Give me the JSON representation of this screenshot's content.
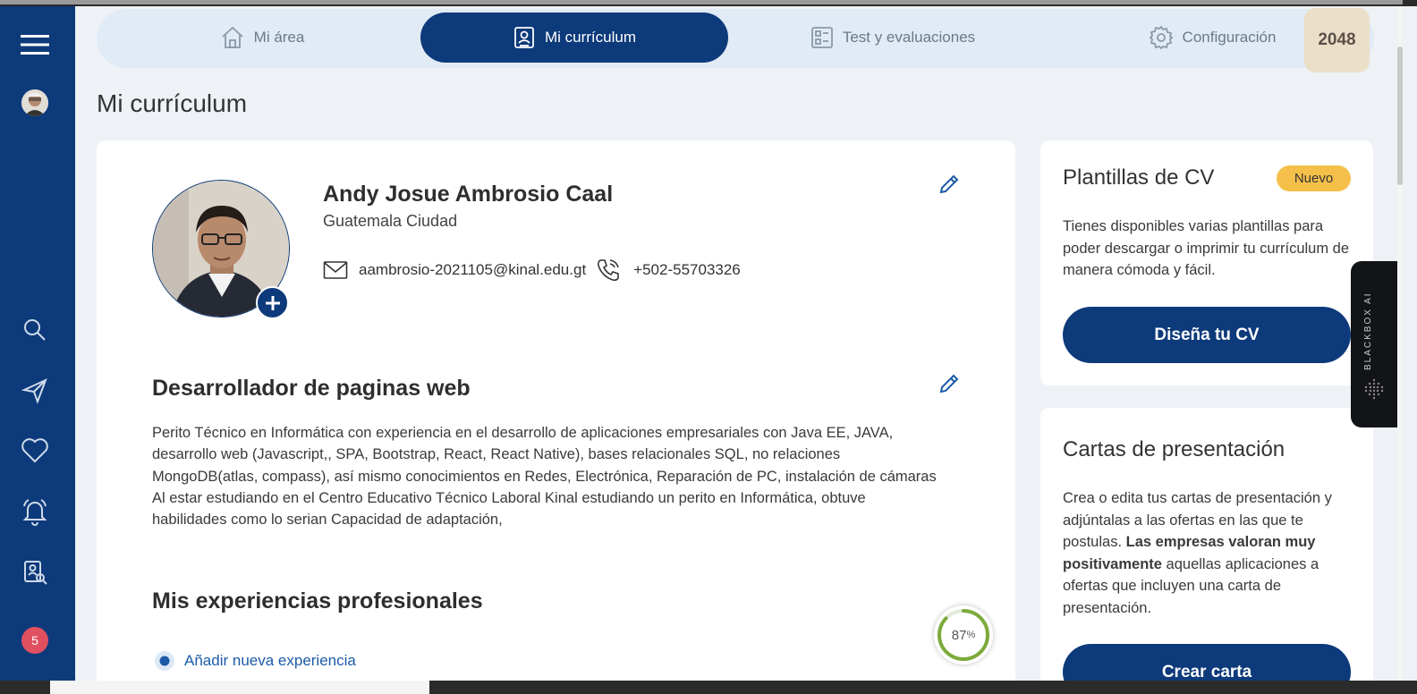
{
  "nav": {
    "tabs": [
      {
        "label": "Mi área",
        "icon": "home-icon"
      },
      {
        "label": "Mi currículum",
        "icon": "resume-icon"
      },
      {
        "label": "Test y evaluaciones",
        "icon": "checklist-icon"
      },
      {
        "label": "Configuración",
        "icon": "gear-icon"
      }
    ],
    "active_tab": "Mi currículum",
    "score": "2048"
  },
  "sidebar": {
    "icons": [
      "menu-icon",
      "avatar",
      "search-icon",
      "send-icon",
      "heart-icon",
      "bell-icon",
      "search-profile-icon"
    ],
    "notification_count": "5"
  },
  "page": {
    "title": "Mi currículum"
  },
  "profile": {
    "name": "Andy Josue Ambrosio Caal",
    "city": "Guatemala Ciudad",
    "email": "aambrosio-2021105@kinal.edu.gt",
    "phone": "+502-55703326"
  },
  "summary": {
    "headline": "Desarrollador de paginas web",
    "description": "Perito Técnico en Informática con experiencia en el desarrollo de aplicaciones empresariales con Java EE, JAVA, desarrollo web (Javascript,, SPA, Bootstrap, React, React Native), bases relacionales SQL, no relaciones MongoDB(atlas, compass), así mismo conocimientos en Redes, Electrónica, Reparación de PC, instalación de cámaras Al estar estudiando en el Centro Educativo Técnico Laboral Kinal estudiando un perito en Informática, obtuve habilidades como lo serian Capacidad de adaptación,"
  },
  "experience": {
    "heading": "Mis experiencias profesionales",
    "add_label": "Añadir nueva experiencia"
  },
  "progress": {
    "value": 87,
    "label": "87",
    "unit": "%"
  },
  "templates_card": {
    "title": "Plantillas de CV",
    "badge": "Nuevo",
    "text": "Tienes disponibles varias plantillas para poder descargar o imprimir tu currículum de manera cómoda y fácil.",
    "button": "Diseña tu CV"
  },
  "letters_card": {
    "title": "Cartas de presentación",
    "text_before": "Crea o edita tus cartas de presentación y adjúntalas a las ofertas en las que te postulas. ",
    "text_bold": "Las empresas valoran muy positivamente",
    "text_after": " aquellas aplicaciones a ofertas que incluyen una carta de presentación.",
    "button": "Crear carta"
  },
  "blackbox": {
    "label": "BLACKBOX AI"
  },
  "colors": {
    "primary": "#0d3a7a",
    "badge": "#f5c04a",
    "progress": "#7caa3c",
    "notification": "#e05060"
  }
}
